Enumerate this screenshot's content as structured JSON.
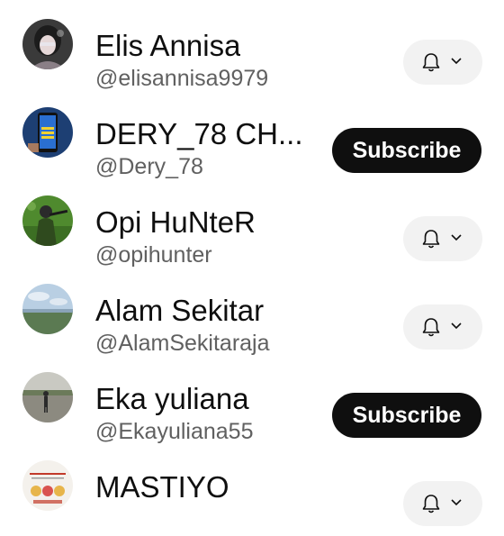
{
  "subscriptions": [
    {
      "name": "Elis Annisa",
      "handle": "@elisannisa9979",
      "button": "bell",
      "avatar_icon": "profile-photo-woman"
    },
    {
      "name": "DERY_78 CH...",
      "handle": "@Dery_78",
      "button": "subscribe",
      "avatar_icon": "phone-screen-photo"
    },
    {
      "name": "Opi HuNteR",
      "handle": "@opihunter",
      "button": "bell",
      "avatar_icon": "hunter-in-field-photo"
    },
    {
      "name": "Alam Sekitar",
      "handle": "@AlamSekitaraja",
      "button": "bell",
      "avatar_icon": "landscape-sky-photo"
    },
    {
      "name": "Eka yuliana",
      "handle": "@Ekayuliana55",
      "button": "subscribe",
      "avatar_icon": "person-on-road-photo"
    },
    {
      "name": "MASTIYO",
      "handle": "",
      "button": "bell",
      "avatar_icon": "food-menu-photo"
    }
  ],
  "labels": {
    "subscribe": "Subscribe"
  },
  "colors": {
    "subscribe_bg": "#0f0f0f",
    "bell_bg": "#f2f2f2",
    "name_text": "#0f0f0f",
    "handle_text": "#606060"
  }
}
